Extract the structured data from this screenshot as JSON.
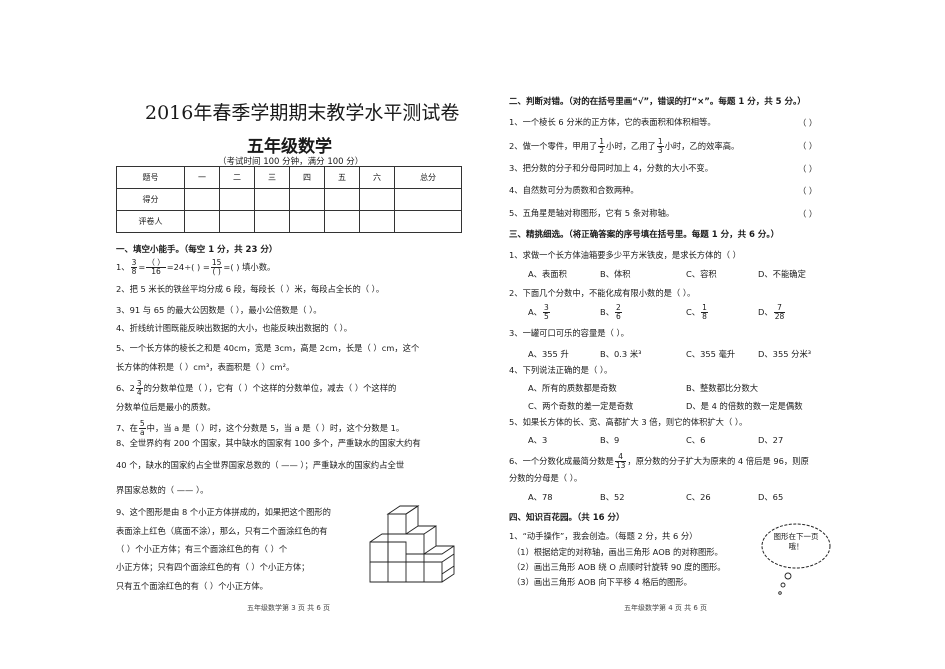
{
  "left": {
    "title": "2016年春季学期期末教学水平测试卷",
    "subtitle": "五年级数学",
    "note": "（考试时间 100 分钟，满分 100 分）",
    "table": {
      "row1": [
        "题号",
        "一",
        "二",
        "三",
        "四",
        "五",
        "六",
        "总分"
      ],
      "row2_label": "得分",
      "row3_label": "评卷人"
    },
    "section1": "一、填空小能手。（每空 1 分，共 23 分）",
    "q1_prefix": "1、",
    "q1_f1n": "3",
    "q1_f1d": "8",
    "q1_f2n": "（       ）",
    "q1_f2d": "16",
    "q1_mid": "=24÷(        ) =",
    "q1_f3n": "15",
    "q1_f3d": "(        )",
    "q1_end": "=(          ) 填小数。",
    "q2": "2、把 5 米长的铁丝平均分成 6 段，每段长（          ）米，每段占全长的（      ）。",
    "q3": "3、91 与 65 的最大公因数是（            ），最小公倍数是（          ）。",
    "q4": "4、折线统计图既能反映出数据的大小，也能反映出数据的（                        ）。",
    "q5a": "5、一个长方体的棱长之和是 40cm，宽是 3cm，高是 2cm，长是（        ）cm，这个",
    "q5b": "长方体的体积是（          ）cm³，表面积是（          ）cm²。",
    "q6_pre": "6、2",
    "q6_fn": "3",
    "q6_fd": "4",
    "q6a": "的分数单位是（          ），它有（        ）个这样的分数单位，减去（        ）个这样的",
    "q6b": "分数单位后是最小的质数。",
    "q7_pre": "7、在",
    "q7_fn": "5",
    "q7_fd": "a",
    "q7a": "中，当 a 是（        ）时，这个分数是 5，当 a 是（        ）时，这个分数是 1。",
    "q8a": "8、全世界约有 200 个国家，其中缺水的国家有 100 多个，严重缺水的国家大约有",
    "q8b": "40 个，缺水的国家约占全世界国家总数的（ —— ）；严重缺水的国家约占全世",
    "q8c": "界国家总数的（ —— ）。",
    "q9a": "9、这个图形是由 8 个小正方体拼成的，如果把这个图形的",
    "q9b": "表面涂上红色（底面不涂），那么，只有二个面涂红色的有",
    "q9c": "（        ）个小正方体；有三个面涂红色的有（            ）个",
    "q9d": "小正方体；只有四个面涂红色的有（            ）个小正方体；",
    "q9e": "只有五个面涂红色的有（        ）个小正方体。",
    "footer": "五年级数学第 3 页   共 6 页"
  },
  "right": {
    "section2": "二、判断对错。（对的在括号里画“√”，错误的打“×”。每题 1 分，共 5 分。）",
    "j1": "1、一个棱长 6 分米的正方体，它的表面积和体积相等。",
    "j2_pre": "2、做一个零件，甲用了",
    "j2_f1n": "1",
    "j2_f1d": "2",
    "j2_mid": "小时，乙用了",
    "j2_f2n": "1",
    "j2_f2d": "3",
    "j2_end": "小时，乙的效率高。",
    "j3": "3、把分数的分子和分母同时加上 4，分数的大小不变。",
    "j4": "4、自然数可分为质数和合数两种。",
    "j5": "5、五角星是轴对称图形，它有 5 条对称轴。",
    "paren": "（          ）",
    "section3": "三、精挑细选。（将正确答案的序号填在括号里。每题 1 分，共 6 分。）",
    "c1": "1、求做一个长方体油箱要多少平方米铁皮，是求长方体的（          ）",
    "c1_opts": [
      "A、表面积",
      "B、体积",
      "C、容积",
      "D、不能确定"
    ],
    "c2": "2、下面几个分数中，不能化成有限小数的是（      ）。",
    "c2_opts": [
      {
        "label": "A、",
        "n": "3",
        "d": "5"
      },
      {
        "label": "B、",
        "n": "2",
        "d": "6"
      },
      {
        "label": "C、",
        "n": "1",
        "d": "8"
      },
      {
        "label": "D、",
        "n": "7",
        "d": "28"
      }
    ],
    "c3": "3、一罐可口可乐的容量是（          ）。",
    "c3_opts": [
      "A、355 升",
      "B、0.3 米³",
      "C、355 毫升",
      "D、355 分米³"
    ],
    "c4": "4、下列说法正确的是（          ）。",
    "c4_opts": [
      "A、所有的质数都是奇数",
      "B、整数都比分数大",
      "C、两个奇数的差一定是奇数",
      "D、是 4 的倍数的数一定是偶数"
    ],
    "c5": "5、如果长方体的长、宽、高都扩大 3 倍，则它的体积扩大（      ）。",
    "c5_opts": [
      "A、3",
      "B、9",
      "C、6",
      "D、27"
    ],
    "c6_pre": "6、一个分数化成最简分数是",
    "c6_fn": "4",
    "c6_fd": "13",
    "c6_end": "，原分数的分子扩大为原来的 4 倍后是 96，则原",
    "c6b": "分数的分母是（        ）。",
    "c6_opts": [
      "A、78",
      "B、52",
      "C、26",
      "D、65"
    ],
    "section4": "四、知识百花园。（共 16 分）",
    "k1": "1、“动手操作”，我会创造。（每题 2 分，共 6 分）",
    "k1a": "（1）根据给定的对称轴，画出三角形 AOB 的对称图形。",
    "k1b": "（2）画出三角形 AOB 绕 O 点顺时针旋转 90 度的图形。",
    "k1c": "（3）画出三角形 AOB 向下平移 4 格后的图形。",
    "bubble": "图形在下一页哦！",
    "footer": "五年级数学第 4 页   共 6 页"
  }
}
